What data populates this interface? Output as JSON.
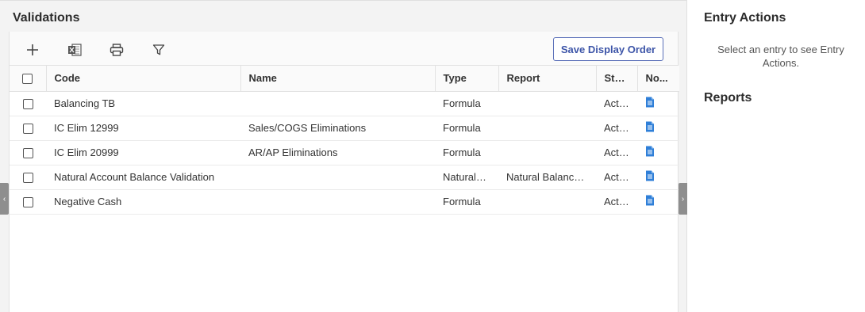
{
  "main": {
    "title": "Validations",
    "save_display_order_label": "Save Display Order"
  },
  "toolbar_icons": [
    "add-icon",
    "excel-icon",
    "print-icon",
    "filter-icon"
  ],
  "table": {
    "columns": [
      "Code",
      "Name",
      "Type",
      "Report",
      "Sta...",
      "No..."
    ],
    "rows": [
      {
        "code": "Balancing TB",
        "name": "",
        "type": "Formula",
        "report": "",
        "status": "Active"
      },
      {
        "code": "IC Elim 12999",
        "name": "Sales/COGS Eliminations",
        "type": "Formula",
        "report": "",
        "status": "Active"
      },
      {
        "code": "IC Elim 20999",
        "name": "AR/AP Eliminations",
        "type": "Formula",
        "report": "",
        "status": "Active"
      },
      {
        "code": "Natural Account Balance Validation",
        "name": "",
        "type": "NaturalBa...",
        "report": "Natural Balance ...",
        "status": "Active"
      },
      {
        "code": "Negative Cash",
        "name": "",
        "type": "Formula",
        "report": "",
        "status": "Active"
      }
    ]
  },
  "side": {
    "entry_actions_title": "Entry Actions",
    "entry_actions_message": "Select an entry to see Entry Actions.",
    "reports_title": "Reports"
  },
  "colors": {
    "accent": "#3d55a8",
    "doc_icon": "#2f7fd8"
  }
}
